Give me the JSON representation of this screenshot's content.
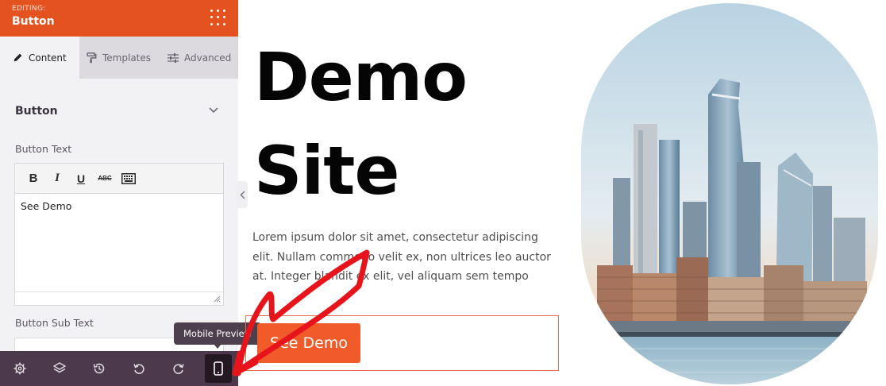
{
  "panel": {
    "editing_label": "EDITING:",
    "element_name": "Button",
    "tabs": [
      {
        "label": "Content",
        "icon": "pencil-icon",
        "active": true
      },
      {
        "label": "Templates",
        "icon": "paint-roller-icon",
        "active": false
      },
      {
        "label": "Advanced",
        "icon": "sliders-icon",
        "active": false
      }
    ],
    "section_title": "Button",
    "button_text_label": "Button Text",
    "button_text_value": "See Demo",
    "button_subtext_label": "Button Sub Text",
    "toolbar": {
      "bold": "B",
      "italic": "I",
      "underline": "U",
      "strikethrough": "ABC"
    }
  },
  "bottom_bar": {
    "buttons": [
      "gear-icon",
      "layers-icon",
      "history-icon",
      "undo-icon",
      "redo-icon",
      "mobile-preview-icon"
    ],
    "tooltip": "Mobile Preview"
  },
  "page": {
    "title_line1": "Demo",
    "title_line2": "Site",
    "body_text": "Lorem ipsum dolor sit amet, consectetur adipiscing elit. Nullam commodo velit ex, non ultrices leo auctor at. Integer blandit ex elit, vel aliquam sem tempo",
    "button_label": "See Demo"
  },
  "colors": {
    "header_orange": "#e4521f",
    "button_orange": "#f15a29",
    "bottom_bar": "#4c3a4c",
    "annotation_red": "#e8141b"
  }
}
